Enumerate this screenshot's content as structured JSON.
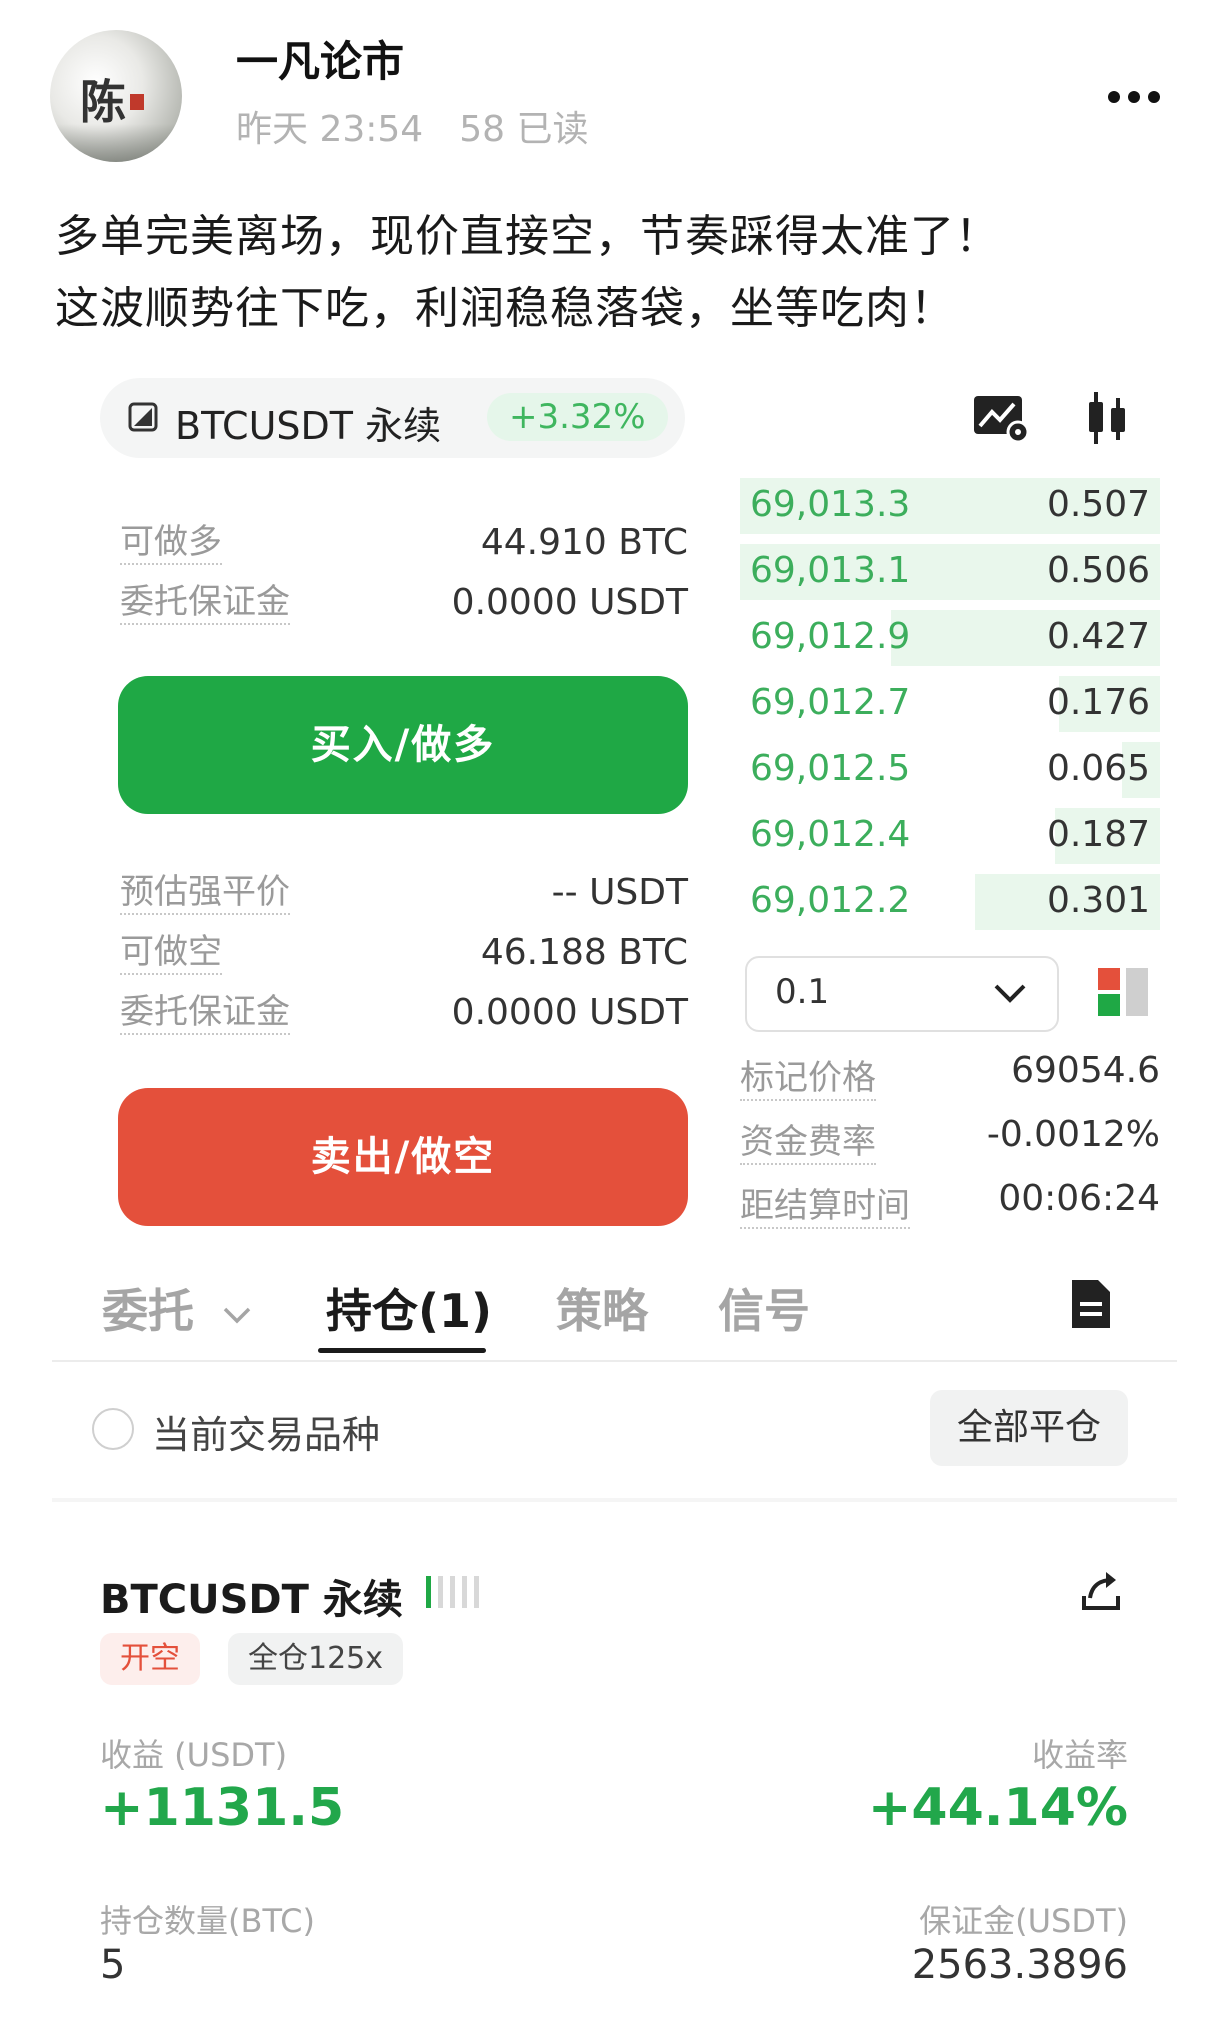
{
  "post": {
    "author": "一凡论市",
    "time": "昨天 23:54",
    "reads": "58 已读",
    "avatar_char": "陈",
    "line1": "多单完美离场，现价直接空，节奏踩得太准了！",
    "line2": "这波顺势往下吃，利润稳稳落袋，坐等吃肉！"
  },
  "trade": {
    "symbol": "BTCUSDT 永续",
    "change": "+3.32%",
    "long_avail_label": "可做多",
    "long_avail_value": "44.910 BTC",
    "long_margin_label": "委托保证金",
    "long_margin_value": "0.0000 USDT",
    "buy_label": "买入/做多",
    "liq_label": "预估强平价",
    "liq_value": "-- USDT",
    "short_avail_label": "可做空",
    "short_avail_value": "46.188 BTC",
    "short_margin_label": "委托保证金",
    "short_margin_value": "0.0000 USDT",
    "sell_label": "卖出/做空"
  },
  "orderbook": {
    "rows": [
      {
        "price": "69,013.3",
        "qty": "0.507",
        "depth": 1.0
      },
      {
        "price": "69,013.1",
        "qty": "0.506",
        "depth": 1.0
      },
      {
        "price": "69,012.9",
        "qty": "0.427",
        "depth": 0.64
      },
      {
        "price": "69,012.7",
        "qty": "0.176",
        "depth": 0.24
      },
      {
        "price": "69,012.5",
        "qty": "0.065",
        "depth": 0.09
      },
      {
        "price": "69,012.4",
        "qty": "0.187",
        "depth": 0.25
      },
      {
        "price": "69,012.2",
        "qty": "0.301",
        "depth": 0.44
      }
    ],
    "step": "0.1",
    "mark_label": "标记价格",
    "mark_value": "69054.6",
    "funding_label": "资金费率",
    "funding_value": "-0.0012%",
    "settle_label": "距结算时间",
    "settle_value": "00:06:24"
  },
  "tabs": {
    "orders": "委托",
    "positions": "持仓(1)",
    "strategy": "策略",
    "signals": "信号"
  },
  "filter": {
    "current_symbol": "当前交易品种",
    "close_all": "全部平仓"
  },
  "position": {
    "title": "BTCUSDT 永续",
    "side": "开空",
    "margin_mode": "全仓125x",
    "pnl_label": "收益 (USDT)",
    "pnl_value": "+1131.5",
    "roe_label": "收益率",
    "roe_value": "+44.14%",
    "size_label": "持仓数量(BTC)",
    "size_value": "5",
    "margin_label": "保证金(USDT)",
    "margin_value": "2563.3896"
  },
  "colors": {
    "buy": "#1fa845",
    "sell": "#e4503b",
    "bid_text": "#3cae5c",
    "depth_bar": "#e9f7ec"
  }
}
